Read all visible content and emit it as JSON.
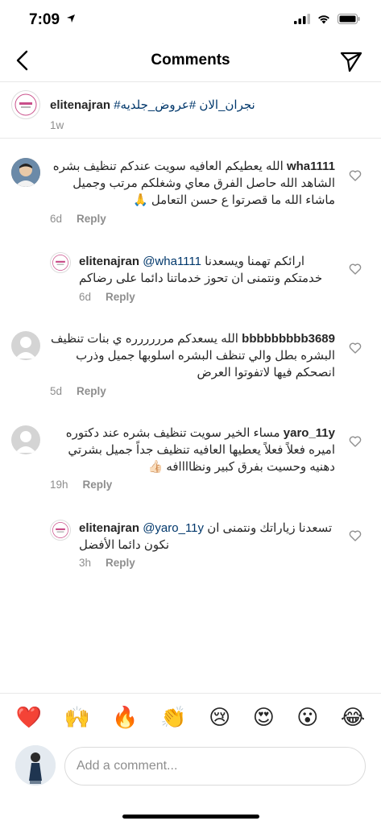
{
  "status": {
    "time": "7:09"
  },
  "nav": {
    "title": "Comments",
    "back_icon": "chevron-left-icon",
    "send_icon": "paper-plane-icon"
  },
  "caption": {
    "username": "elitenajran",
    "hashtags": "#نجران_الان #عروض_جلديه",
    "time": "1w"
  },
  "comments": [
    {
      "username": "wha1111",
      "text": "الله يعطيكم العافيه سويت عندكم تنظيف بشره الشاهد الله حاصل الفرق معاي وشغلكم مرتب وجميل ماشاء الله ما قصرتوا ع حسن التعامل 🙏",
      "time": "6d",
      "reply_label": "Reply"
    },
    {
      "username": "elitenajran",
      "mention": "@wha1111",
      "text": "ارائكم تهمنا ويسعدنا خدمتكم ونتمنى ان تحوز خدماتنا دائما على رضاكم",
      "time": "6d",
      "reply_label": "Reply"
    },
    {
      "username": "bbbbbbbbb3689",
      "text": "الله يسعدكم مرررررره ي بنات تنظيف البشره بطل والي تنظف البشره اسلوبها جميل وذرب انصحكم فيها لاتفوتوا العرض",
      "time": "5d",
      "reply_label": "Reply"
    },
    {
      "username": "yaro_11y",
      "text": "مساء الخير سويت تنظيف بشره عند دكتوره اميره فعلاً فعلاً يعطيها العافيه تنظيف جداً جميل بشرتي دهنيه وحسيت بفرق كبير ونظاااافه 👍🏻",
      "time": "19h",
      "reply_label": "Reply"
    },
    {
      "username": "elitenajran",
      "mention": "@yaro_11y",
      "text": "تسعدنا زياراتك ونتمنى ان نكون دائما الأفضل",
      "time": "3h",
      "reply_label": "Reply"
    }
  ],
  "emojis": [
    "❤️",
    "🙌",
    "🔥",
    "👏",
    "😢",
    "😍",
    "😮",
    "😂"
  ],
  "input": {
    "placeholder": "Add a comment..."
  }
}
